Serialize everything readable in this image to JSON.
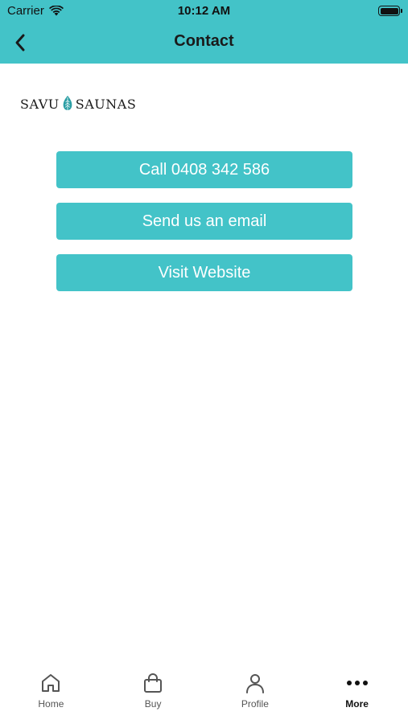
{
  "status_bar": {
    "carrier": "Carrier",
    "time": "10:12 AM"
  },
  "header": {
    "title": "Contact",
    "background": "#43c3c8"
  },
  "logo": {
    "left_text": "SAVU",
    "right_text": "SAUNAS",
    "icon": "leaf-icon"
  },
  "actions": [
    {
      "label": "Call 0408 342 586"
    },
    {
      "label": "Send us an email"
    },
    {
      "label": "Visit Website"
    }
  ],
  "tab_bar": {
    "items": [
      {
        "label": "Home",
        "icon": "home-icon"
      },
      {
        "label": "Buy",
        "icon": "shopping-bag-icon"
      },
      {
        "label": "Profile",
        "icon": "person-icon"
      },
      {
        "label": "More",
        "icon": "more-dots-icon",
        "active": true
      }
    ]
  },
  "colors": {
    "accent": "#43c3c8",
    "logo_leaf": "#2a9ea4"
  }
}
